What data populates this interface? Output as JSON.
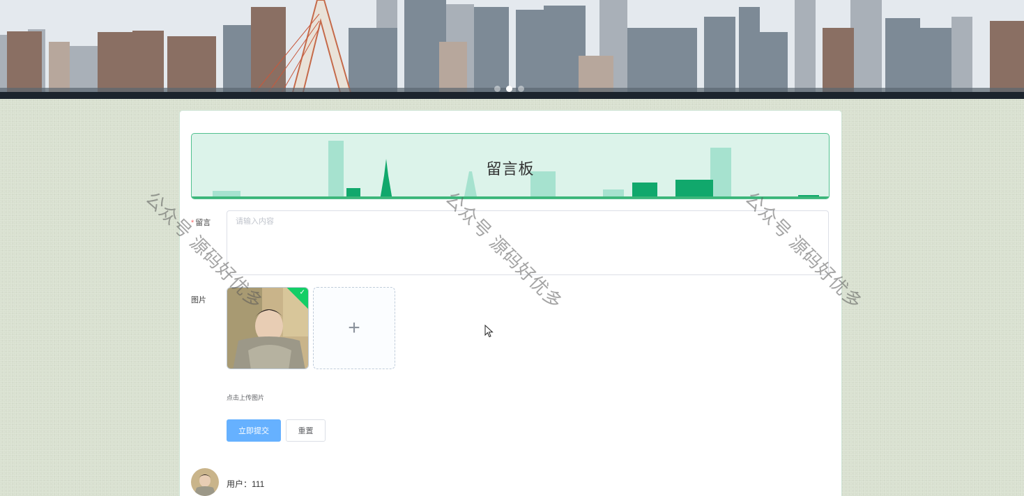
{
  "banner": {
    "slides": 3,
    "active_slide": 2
  },
  "board": {
    "title": "留言板"
  },
  "form": {
    "message_label": "留言",
    "message_placeholder": "请输入内容",
    "image_label": "图片",
    "upload_tip": "点击上传图片",
    "upload_plus": "+",
    "submit_label": "立即提交",
    "reset_label": "重置"
  },
  "comment": {
    "user_text": "用户：111"
  },
  "watermark": {
    "text": "公众号 源码好优多"
  },
  "colors": {
    "primary": "#66b1ff",
    "header_bg": "#dcf3ea",
    "header_accent": "#11a86c",
    "success": "#13ce66",
    "page_bg": "#d8e0cf"
  }
}
